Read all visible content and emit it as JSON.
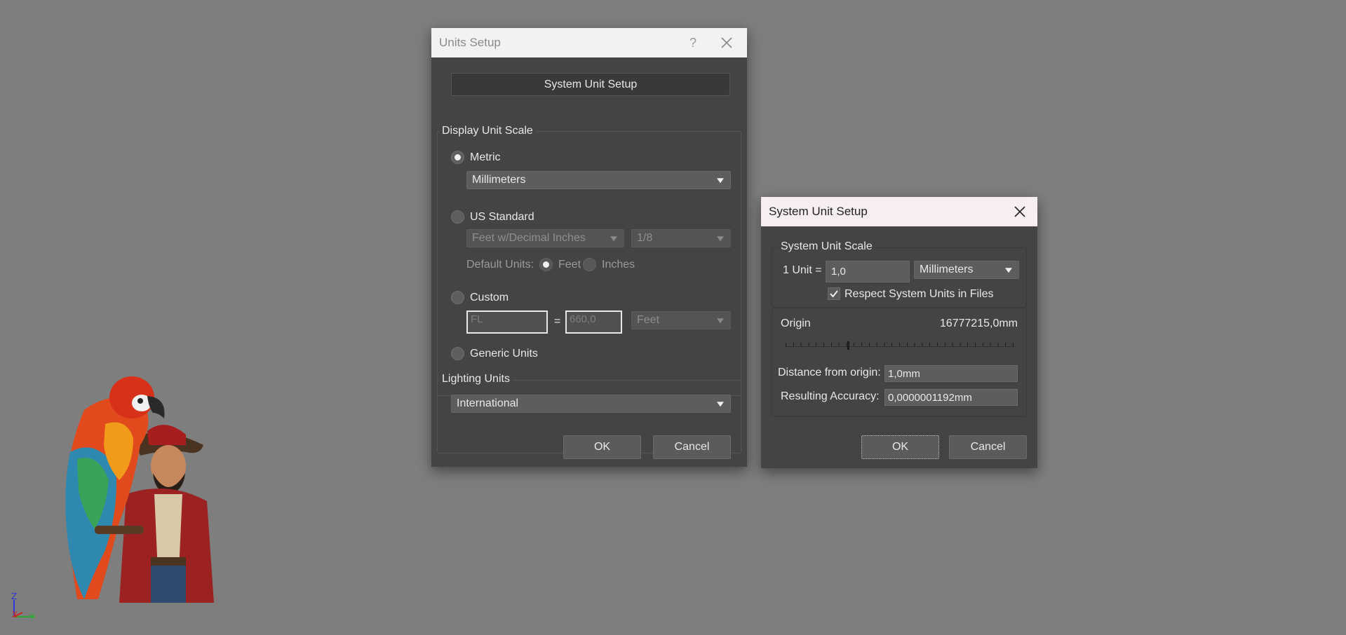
{
  "colors": {
    "background": "#7e7e7e",
    "dialog_body": "#444444",
    "units_titlebar": "#f2f2f2",
    "system_titlebar": "#f7eef0",
    "button": "#5b5b5b"
  },
  "viewport": {
    "axis": {
      "z": "Z",
      "x": "X",
      "y": "Y"
    }
  },
  "units_setup": {
    "title": "Units Setup",
    "help_icon": "?",
    "close_icon": "close-icon",
    "system_unit_setup_button": "System Unit Setup",
    "display_unit_scale": {
      "label": "Display Unit Scale",
      "metric_label": "Metric",
      "metric_selected": true,
      "metric_unit": "Millimeters",
      "us_standard_label": "US Standard",
      "us_unit": "Feet w/Decimal Inches",
      "us_fraction": "1/8",
      "default_units_label": "Default Units:",
      "feet_label": "Feet",
      "inches_label": "Inches",
      "custom_label": "Custom",
      "custom_name": "FL",
      "equals": "=",
      "custom_value": "660,0",
      "custom_unit": "Feet",
      "generic_label": "Generic Units"
    },
    "lighting_units": {
      "label": "Lighting Units",
      "value": "International"
    },
    "ok_label": "OK",
    "cancel_label": "Cancel"
  },
  "system_unit_setup": {
    "title": "System Unit Setup",
    "close_icon": "close-icon",
    "scale_group_label": "System Unit Scale",
    "one_unit_label": "1 Unit =",
    "unit_value": "1,0",
    "unit_type": "Millimeters",
    "respect_label": "Respect System Units in Files",
    "respect_checked": true,
    "origin_label": "Origin",
    "origin_value": "16777215,0mm",
    "origin_slider_fraction": 0.27,
    "distance_label": "Distance from origin:",
    "distance_value": "1,0mm",
    "accuracy_label": "Resulting Accuracy:",
    "accuracy_value": "0,0000001192mm",
    "ok_label": "OK",
    "cancel_label": "Cancel"
  }
}
